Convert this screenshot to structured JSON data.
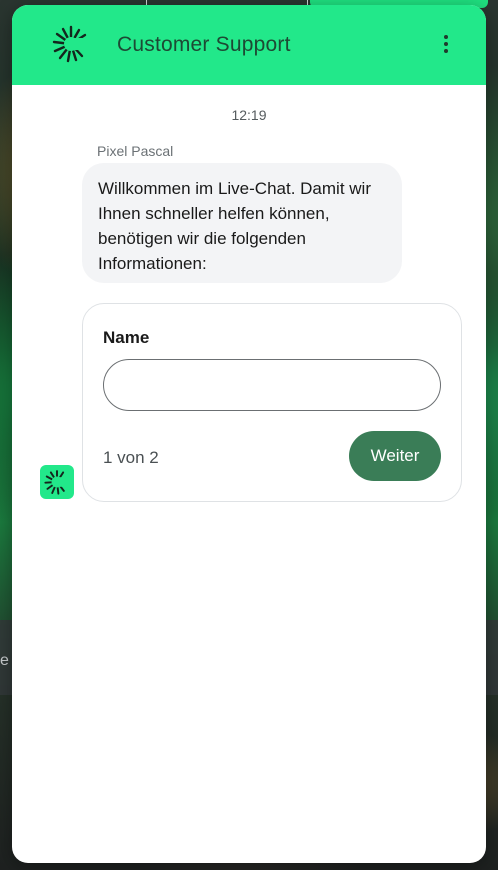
{
  "header": {
    "title": "Customer Support",
    "logo_icon": "sunburst-c-logo-icon",
    "menu_icon": "more-vertical-icon"
  },
  "chat": {
    "timestamp": "12:19",
    "sender_name": "Pixel Pascal",
    "message": "Willkommen im Live-Chat. Damit wir Ihnen schneller helfen können, benötigen wir die folgenden Informationen:",
    "avatar_icon": "sunburst-c-avatar-icon"
  },
  "form": {
    "field_label": "Name",
    "field_value": "",
    "step_text": "1 von 2",
    "next_label": "Weiter"
  },
  "background": {
    "partial_text": "e"
  },
  "colors": {
    "accent": "#22e88a",
    "button": "#3a7d57",
    "title_text": "#1d4a34"
  }
}
